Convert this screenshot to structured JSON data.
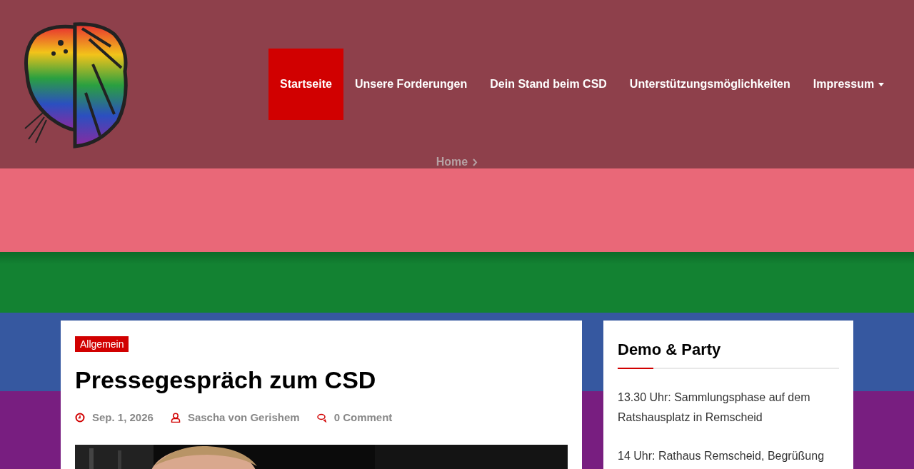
{
  "nav": [
    {
      "label": "Startseite",
      "selected": true,
      "has_menu": false
    },
    {
      "label": "Unsere Forderungen",
      "selected": false,
      "has_menu": false
    },
    {
      "label": "Dein Stand beim CSD",
      "selected": false,
      "has_menu": false
    },
    {
      "label": "Unterstützungsmöglichkeiten",
      "selected": false,
      "has_menu": false
    },
    {
      "label": "Impressum",
      "selected": false,
      "has_menu": true
    }
  ],
  "breadcrumb": [
    "Home"
  ],
  "article": {
    "category": "Allgemein",
    "title": "Pressegespräch zum CSD",
    "date": "Sep. 1, 2026",
    "author": "Sascha von Gerishem",
    "comments": "0 Comment"
  },
  "sidebar": {
    "title": "Demo & Party",
    "items": [
      "13.30 Uhr: Sammlungsphase auf dem Ratshausplatz in Remscheid",
      "14 Uhr: Rathaus Remscheid, Begrüßung"
    ]
  }
}
